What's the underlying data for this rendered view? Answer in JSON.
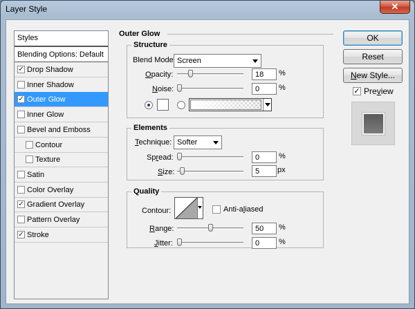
{
  "window": {
    "title": "Layer Style",
    "close_glyph": "✕"
  },
  "styles_list": {
    "header": "Styles",
    "blending": "Blending Options: Default",
    "items": [
      {
        "label": "Drop Shadow",
        "checked": true
      },
      {
        "label": "Inner Shadow",
        "checked": false
      },
      {
        "label": "Outer Glow",
        "checked": true,
        "selected": true
      },
      {
        "label": "Inner Glow",
        "checked": false
      },
      {
        "label": "Bevel and Emboss",
        "checked": false
      },
      {
        "label": "Contour",
        "checked": false,
        "indent": true
      },
      {
        "label": "Texture",
        "checked": false,
        "indent": true
      },
      {
        "label": "Satin",
        "checked": false
      },
      {
        "label": "Color Overlay",
        "checked": false
      },
      {
        "label": "Gradient Overlay",
        "checked": true
      },
      {
        "label": "Pattern Overlay",
        "checked": false
      },
      {
        "label": "Stroke",
        "checked": true
      }
    ]
  },
  "outer_glow": {
    "title": "Outer Glow",
    "structure": {
      "title": "Structure",
      "blend_mode_label": "Blend Mode:",
      "blend_mode_value": "Screen",
      "opacity_label": "Opacity:",
      "opacity_value": "18",
      "opacity_percent": 18,
      "noise_label": "Noise:",
      "noise_value": "0",
      "noise_percent": 0,
      "unit_percent": "%"
    },
    "elements": {
      "title": "Elements",
      "technique_label": "Technique:",
      "technique_value": "Softer",
      "spread_label": "Spread:",
      "spread_value": "0",
      "spread_percent": 0,
      "size_label": "Size:",
      "size_value": "5",
      "size_unit": "px",
      "unit_percent": "%"
    },
    "quality": {
      "title": "Quality",
      "contour_label": "Contour:",
      "antialiased_label": "Anti-aliased",
      "antialiased_checked": false,
      "range_label": "Range:",
      "range_value": "50",
      "range_percent": 50,
      "jitter_label": "Jitter:",
      "jitter_value": "0",
      "jitter_percent": 0,
      "unit_percent": "%"
    }
  },
  "buttons": {
    "ok": "OK",
    "reset": "Reset",
    "new_style": "New Style..."
  },
  "preview": {
    "label": "Preview",
    "checked": true
  },
  "colors": {
    "selection": "#3399ff",
    "glow_swatch": "#ffffff",
    "preview_square": "#666666"
  }
}
